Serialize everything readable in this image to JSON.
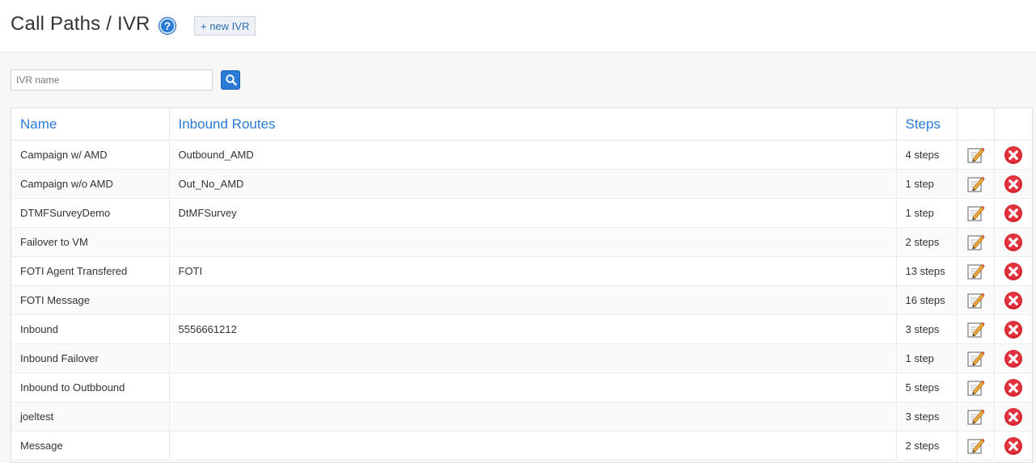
{
  "header": {
    "title": "Call Paths / IVR",
    "help_icon": "question-circle-icon",
    "new_button": "+ new IVR"
  },
  "search": {
    "placeholder": "IVR name",
    "value": "",
    "button_icon": "search-icon"
  },
  "table": {
    "columns": [
      "Name",
      "Inbound Routes",
      "Steps",
      "",
      ""
    ],
    "rows": [
      {
        "name": "Campaign w/ AMD",
        "routes": "Outbound_AMD",
        "steps": "4 steps"
      },
      {
        "name": "Campaign w/o AMD",
        "routes": "Out_No_AMD",
        "steps": "1 step"
      },
      {
        "name": "DTMFSurveyDemo",
        "routes": "DtMFSurvey",
        "steps": "1 step"
      },
      {
        "name": "Failover to VM",
        "routes": "",
        "steps": "2 steps"
      },
      {
        "name": "FOTI Agent Transfered",
        "routes": "FOTI",
        "steps": "13 steps"
      },
      {
        "name": "FOTI Message",
        "routes": "",
        "steps": "16 steps"
      },
      {
        "name": "Inbound",
        "routes": "5556661212",
        "steps": "3 steps"
      },
      {
        "name": "Inbound Failover",
        "routes": "",
        "steps": "1 step"
      },
      {
        "name": "Inbound to Outbbound",
        "routes": "",
        "steps": "5 steps"
      },
      {
        "name": "joeltest",
        "routes": "",
        "steps": "3 steps"
      },
      {
        "name": "Message",
        "routes": "",
        "steps": "2 steps"
      }
    ],
    "row_icons": [
      "edit-icon",
      "delete-icon"
    ]
  },
  "colors": {
    "accent": "#2a7bd6",
    "delete": "#d8252f"
  }
}
